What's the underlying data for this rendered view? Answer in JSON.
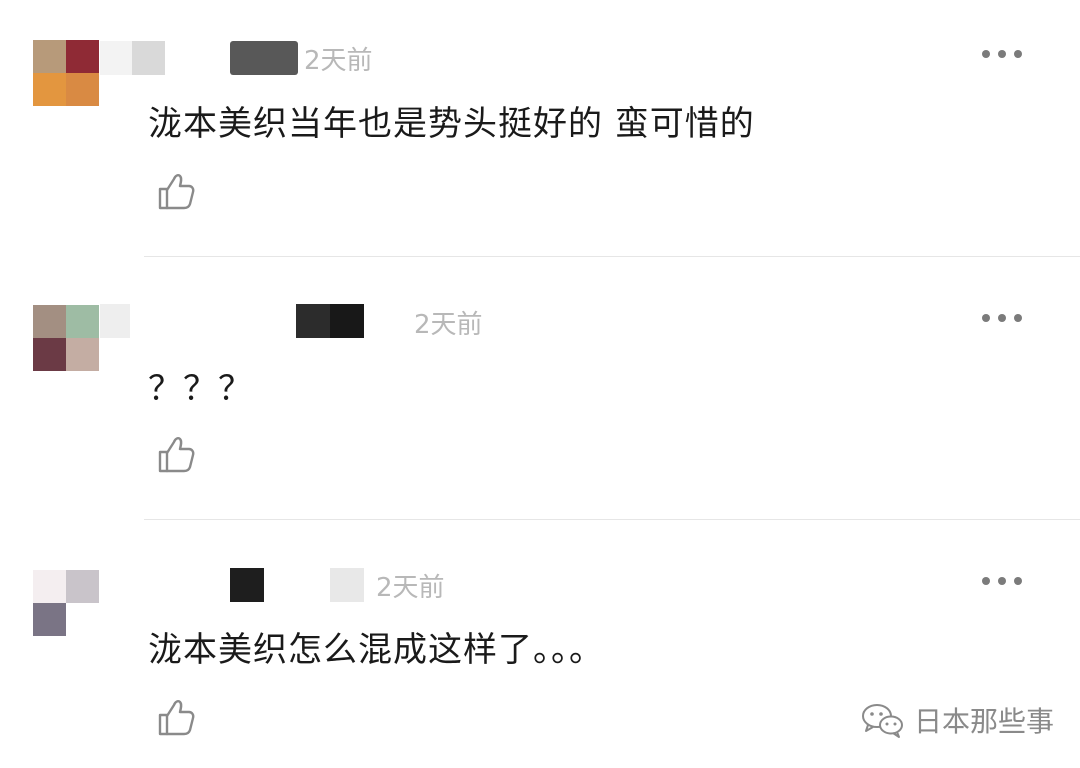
{
  "comments": [
    {
      "time": "2天前",
      "text": "泷本美织当年也是势头挺好的  蛮可惜的",
      "avatar_colors": [
        "#b79a7a",
        "#8f2a35",
        "#e3963f",
        "#d98a43"
      ],
      "name_blur_colors": [
        "#f2f2f2",
        "#dadada",
        "#5a5a5a"
      ]
    },
    {
      "time": "2天前",
      "text": "？？？",
      "avatar_colors": [
        "#a38f82",
        "#9ebca4",
        "#6b3a45",
        "#c4ada3"
      ],
      "name_blur_colors": [
        "#ececec",
        "#2c2c2c",
        "#181818"
      ]
    },
    {
      "time": "2天前",
      "text": "泷本美织怎么混成这样了。。。",
      "avatar_colors": [
        "#f4eef0",
        "#c9c4ca",
        "#7a7485",
        "#ffffff"
      ],
      "name_blur_colors": [
        "#1e1e1e",
        "#e8e8e8"
      ]
    }
  ],
  "icons": {
    "more": "more-dots-icon",
    "like": "thumbs-up-icon",
    "watermark": "wechat-icon"
  },
  "watermark": {
    "text": "日本那些事"
  },
  "colors": {
    "time": "#b8b8b8",
    "text": "#1a1a1a",
    "divider": "#e6e6e6",
    "more": "#7b7b7b",
    "icon_stroke": "#8a8a8a"
  }
}
